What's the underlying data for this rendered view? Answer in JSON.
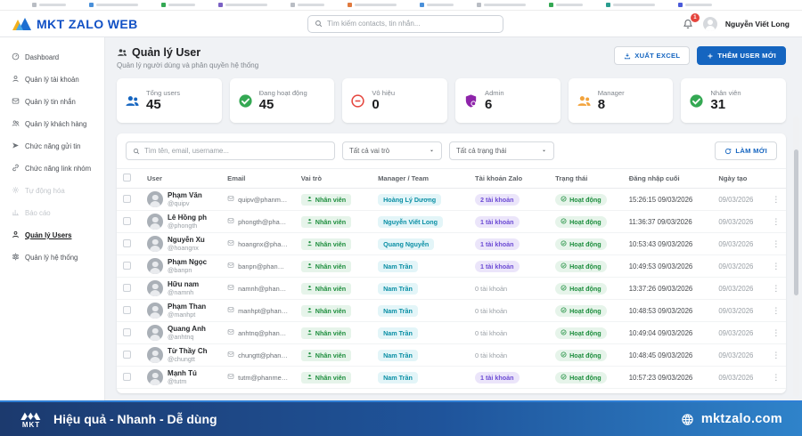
{
  "header": {
    "logo_text": "MKT ZALO WEB",
    "search_placeholder": "Tìm kiếm contacts, tin nhắn...",
    "notification_count": "1",
    "user_name": "Nguyễn Viết Long"
  },
  "sidebar": {
    "items": [
      {
        "label": "Dashboard",
        "icon": "dashboard-icon",
        "active": false,
        "disabled": false
      },
      {
        "label": "Quản lý tài khoản",
        "icon": "account-icon",
        "active": false,
        "disabled": false
      },
      {
        "label": "Quản lý tin nhắn",
        "icon": "message-icon",
        "active": false,
        "disabled": false
      },
      {
        "label": "Quản lý khách hàng",
        "icon": "customers-icon",
        "active": false,
        "disabled": false
      },
      {
        "label": "Chức năng gửi tin",
        "icon": "send-icon",
        "active": false,
        "disabled": false
      },
      {
        "label": "Chức năng link nhóm",
        "icon": "link-icon",
        "active": false,
        "disabled": false
      },
      {
        "label": "Tự động hóa",
        "icon": "automation-icon",
        "active": false,
        "disabled": true
      },
      {
        "label": "Báo cáo",
        "icon": "report-icon",
        "active": false,
        "disabled": true
      },
      {
        "label": "Quản lý Users",
        "icon": "user-icon",
        "active": true,
        "disabled": false
      },
      {
        "label": "Quản lý hệ thống",
        "icon": "system-icon",
        "active": false,
        "disabled": false
      }
    ]
  },
  "page": {
    "title": "Quản lý User",
    "subtitle": "Quản lý người dùng và phân quyền hệ thống",
    "export_label": "XUẤT EXCEL",
    "add_user_label": "THÊM USER MỚI"
  },
  "stats": [
    {
      "label": "Tổng users",
      "value": "45",
      "icon": "users-group-icon",
      "color": "#1565c0"
    },
    {
      "label": "Đang hoạt động",
      "value": "45",
      "icon": "check-circle-icon",
      "color": "#34a853"
    },
    {
      "label": "Vô hiệu",
      "value": "0",
      "icon": "minus-circle-icon",
      "color": "#e5453d"
    },
    {
      "label": "Admin",
      "value": "6",
      "icon": "shield-icon",
      "color": "#8e24aa"
    },
    {
      "label": "Manager",
      "value": "8",
      "icon": "users-group-icon",
      "color": "#f2a33c"
    },
    {
      "label": "Nhân viên",
      "value": "31",
      "icon": "check-circle-icon",
      "color": "#34a853"
    }
  ],
  "filters": {
    "search_placeholder": "Tìm tên, email, username...",
    "role_filter": "Tất cả vai trò",
    "status_filter": "Tất cả trạng thái",
    "refresh_label": "LÀM MỚI"
  },
  "table": {
    "headers": [
      "User",
      "Email",
      "Vai trò",
      "Manager / Team",
      "Tài khoản Zalo",
      "Trạng thái",
      "Đăng nhập cuối",
      "Ngày tạo"
    ],
    "rows": [
      {
        "name": "Phạm Văn",
        "username": "@quipv",
        "email": "quipv@phanmem",
        "role": "Nhân viên",
        "manager": "Hoàng Lý Dương",
        "zalo": "2 tài khoản",
        "zalo_has": true,
        "status": "Hoạt động",
        "last_login": "15:26:15 09/03/2026",
        "created": "09/03/2026"
      },
      {
        "name": "Lê Hồng ph",
        "username": "@phongth",
        "email": "phongth@phanme",
        "role": "Nhân viên",
        "manager": "Nguyễn Viết Long",
        "zalo": "1 tài khoản",
        "zalo_has": true,
        "status": "Hoạt động",
        "last_login": "11:36:37 09/03/2026",
        "created": "09/03/2026"
      },
      {
        "name": "Nguyễn Xu",
        "username": "@hoangnx",
        "email": "hoangnx@phanm",
        "role": "Nhân viên",
        "manager": "Quang Nguyễn",
        "zalo": "1 tài khoản",
        "zalo_has": true,
        "status": "Hoạt động",
        "last_login": "10:53:43 09/03/2026",
        "created": "09/03/2026"
      },
      {
        "name": "Phạm Ngọc",
        "username": "@banpn",
        "email": "banpn@phanmem",
        "role": "Nhân viên",
        "manager": "Nam Trần",
        "zalo": "1 tài khoản",
        "zalo_has": true,
        "status": "Hoạt động",
        "last_login": "10:49:53 09/03/2026",
        "created": "09/03/2026"
      },
      {
        "name": "Hữu nam",
        "username": "@namnh",
        "email": "namnh@phanmem",
        "role": "Nhân viên",
        "manager": "Nam Trần",
        "zalo": "0 tài khoản",
        "zalo_has": false,
        "status": "Hoạt động",
        "last_login": "13:37:26 09/03/2026",
        "created": "09/03/2026"
      },
      {
        "name": "Phạm Than",
        "username": "@manhpt",
        "email": "manhpt@phanme",
        "role": "Nhân viên",
        "manager": "Nam Trần",
        "zalo": "0 tài khoản",
        "zalo_has": false,
        "status": "Hoạt động",
        "last_login": "10:48:53 09/03/2026",
        "created": "09/03/2026"
      },
      {
        "name": "Quang Anh",
        "username": "@anhtnq",
        "email": "anhtnq@phanme",
        "role": "Nhân viên",
        "manager": "Nam Trần",
        "zalo": "0 tài khoản",
        "zalo_has": false,
        "status": "Hoạt động",
        "last_login": "10:49:04 09/03/2026",
        "created": "09/03/2026"
      },
      {
        "name": "Từ Thầy Ch",
        "username": "@chungtt",
        "email": "chungtt@phanme",
        "role": "Nhân viên",
        "manager": "Nam Trần",
        "zalo": "0 tài khoản",
        "zalo_has": false,
        "status": "Hoạt động",
        "last_login": "10:48:45 09/03/2026",
        "created": "09/03/2026"
      },
      {
        "name": "Mạnh Tú",
        "username": "@tutm",
        "email": "tutm@phanmemm",
        "role": "Nhân viên",
        "manager": "Nam Trần",
        "zalo": "1 tài khoản",
        "zalo_has": true,
        "status": "Hoạt động",
        "last_login": "10:57:23 09/03/2026",
        "created": "09/03/2026"
      }
    ]
  },
  "footer": {
    "logo_text": "MKT",
    "slogan": "Hiệu quả - Nhanh - Dễ dùng",
    "website": "mktzalo.com"
  }
}
